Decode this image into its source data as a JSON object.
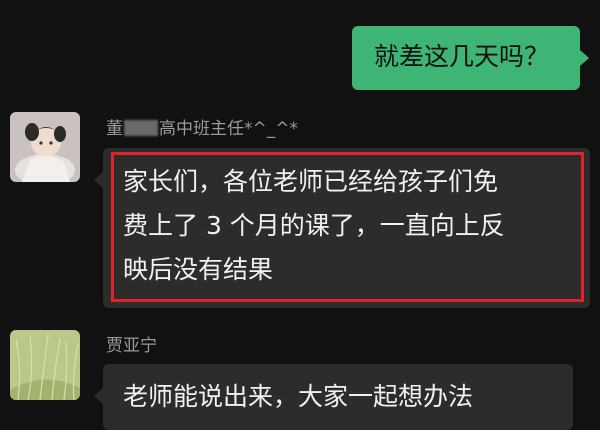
{
  "messages": {
    "outgoing": {
      "text": "就差这几天吗？"
    },
    "teacher": {
      "sender_prefix": "董",
      "sender_suffix": "高中班主任*^_^*",
      "lines": [
        "家长们，各位老师已经给孩子们免",
        "费上了 3 个月的课了，一直向上反",
        "映后没有结果"
      ]
    },
    "parent": {
      "sender": "贾亚宁",
      "text": "老师能说出来，大家一起想办法"
    }
  },
  "colors": {
    "background": "#111111",
    "outgoing_bubble": "#3eb575",
    "incoming_bubble": "#2c2c2c",
    "highlight": "#e0232b"
  }
}
